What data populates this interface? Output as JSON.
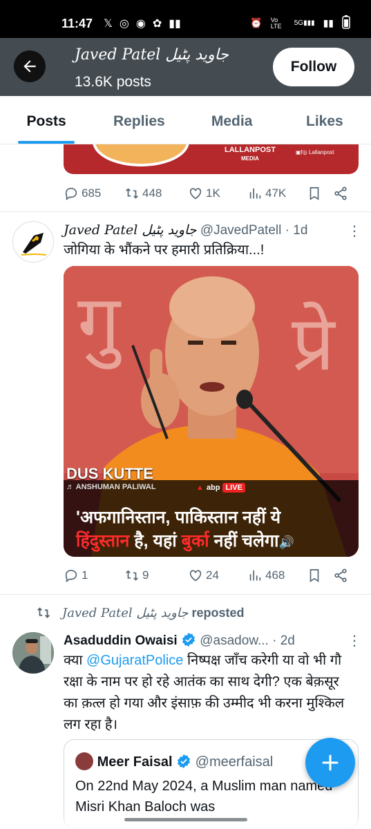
{
  "status_bar": {
    "time": "11:47",
    "left_icons": [
      "x-icon",
      "instagram-icon",
      "chrome-icon",
      "app-icon",
      "signal-bars-icon"
    ],
    "right_icons": [
      "alarm-icon",
      "volte-icon",
      "5g-icon",
      "signal-icon",
      "battery-icon"
    ],
    "volte": "Vo LTE",
    "net": "5G"
  },
  "header": {
    "name": "Javed Patel جاوید پٹیل",
    "posts_count": "13.6K posts",
    "follow_label": "Follow"
  },
  "tabs": [
    {
      "label": "Posts",
      "active": true
    },
    {
      "label": "Replies",
      "active": false
    },
    {
      "label": "Media",
      "active": false
    },
    {
      "label": "Likes",
      "active": false
    }
  ],
  "prev_post": {
    "media_brand": "LALLANPOST",
    "media_brand_sub": "MEDIA",
    "media_brand_handle": "Lallanpost",
    "stats": {
      "replies": "685",
      "reposts": "448",
      "likes": "1K",
      "views": "47K"
    }
  },
  "post1": {
    "author": "Javed Patel جاوید پٹیل",
    "handle": "@JavedPatell",
    "time": "· 1d",
    "text": "जोगिया के भौंकने पर हमारी प्रतिक्रिया...!",
    "image": {
      "song_title": "DUS KUTTE",
      "song_artist": "♬ ANSHUMAN PALIWAL",
      "channel": "abp",
      "live": "LIVE",
      "caption_line1": "'अफगानिस्तान, पाकिस्तान नहीं ये",
      "caption_line2a": "हिंदुस्तान",
      "caption_line2b": " है, यहां ",
      "caption_line2c": "बुर्का",
      "caption_line2d": " नहीं चलेगा"
    },
    "stats": {
      "replies": "1",
      "reposts": "9",
      "likes": "24",
      "views": "468"
    }
  },
  "repost": {
    "by": "Javed Patel جاوید پٹیل",
    "suffix": "reposted"
  },
  "post2": {
    "author": "Asaduddin Owaisi",
    "handle": "@asadow...",
    "time": "· 2d",
    "text_prefix": "क्या ",
    "mention": "@GujaratPolice",
    "text_rest": " निष्पक्ष जाँच करेगी या वो भी गौ रक्षा के नाम पर हो रहे आतंक का साथ देगी? एक बेक़सूर का क़त्ल हो गया और इंसाफ़ की उम्मीद भी करना मुश्किल लग रहा है।",
    "quote": {
      "author": "Meer Faisal",
      "handle": "@meerfaisal",
      "text": "On 22nd May 2024, a Muslim man named Misri Khan Baloch was"
    }
  },
  "colors": {
    "accent": "#1d9bf0",
    "header_bg": "#444c52",
    "muted": "#536471"
  }
}
